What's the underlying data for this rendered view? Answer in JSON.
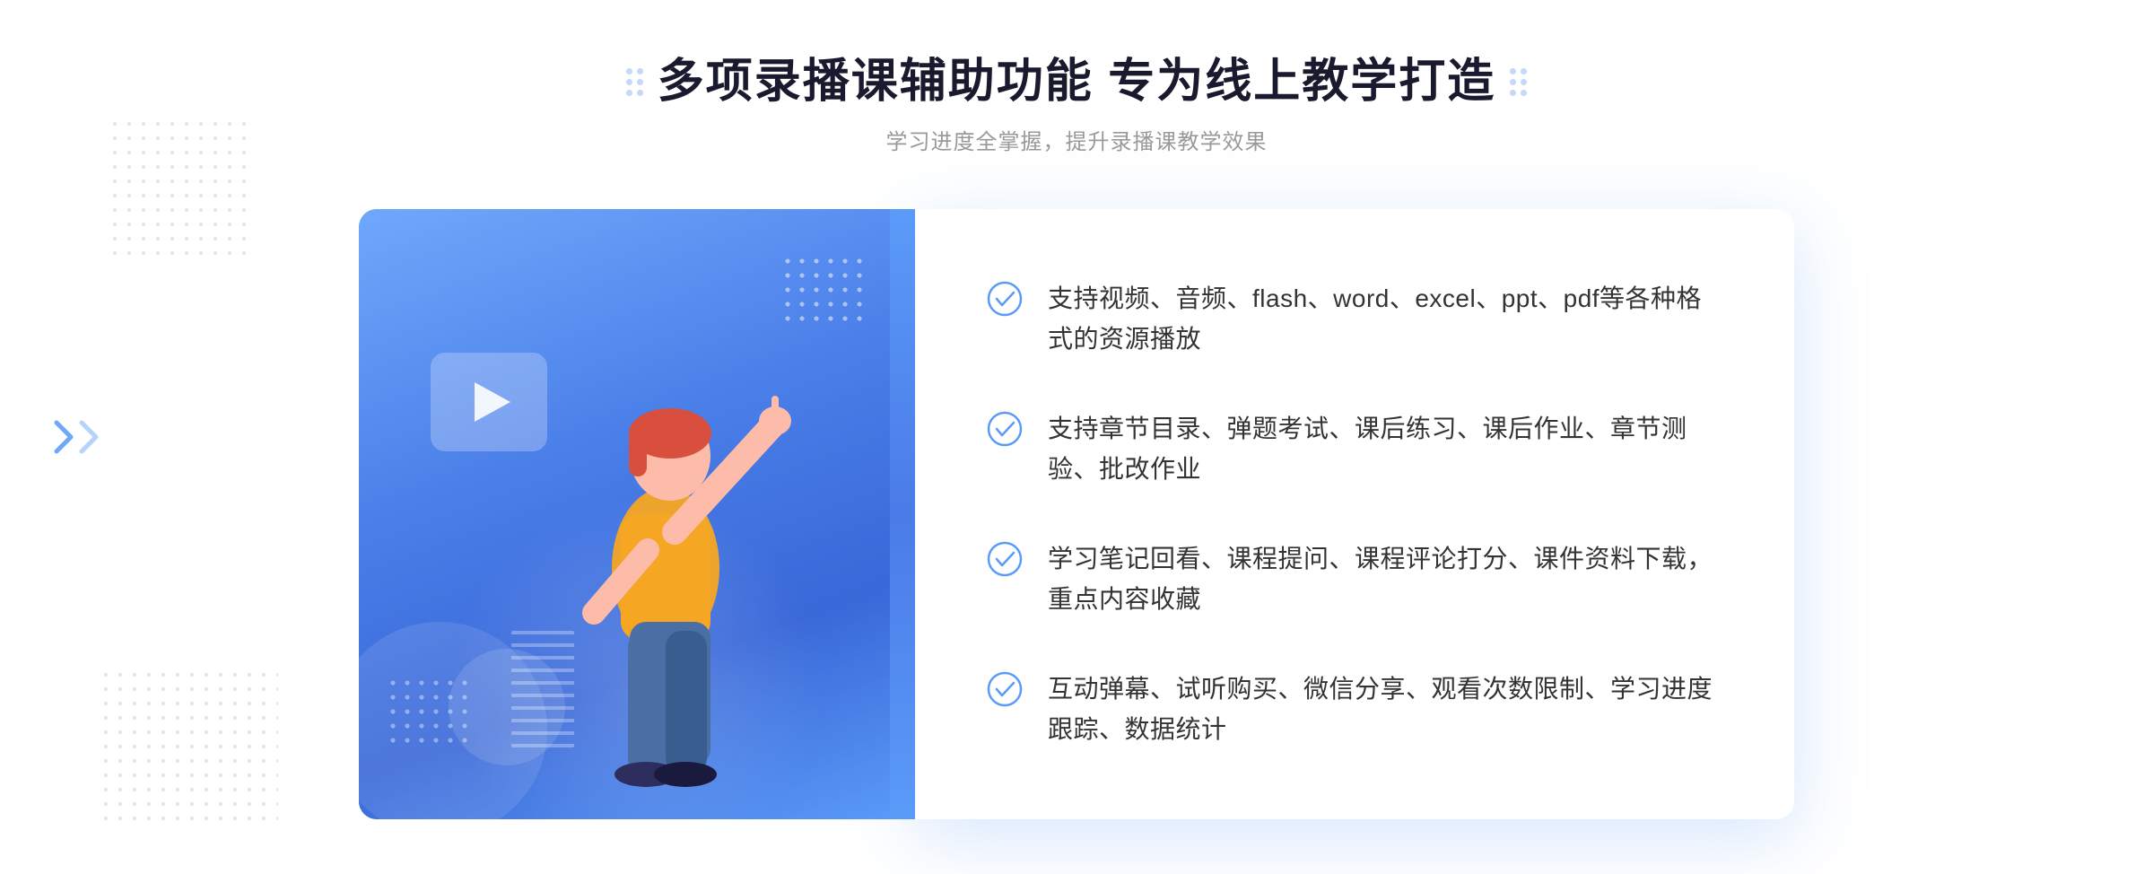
{
  "page": {
    "background": "#ffffff"
  },
  "header": {
    "title": "多项录播课辅助功能 专为线上教学打造",
    "subtitle": "学习进度全掌握，提升录播课教学效果"
  },
  "features": [
    {
      "id": 1,
      "text": "支持视频、音频、flash、word、excel、ppt、pdf等各种格式的资源播放"
    },
    {
      "id": 2,
      "text": "支持章节目录、弹题考试、课后练习、课后作业、章节测验、批改作业"
    },
    {
      "id": 3,
      "text": "学习笔记回看、课程提问、课程评论打分、课件资料下载，重点内容收藏"
    },
    {
      "id": 4,
      "text": "互动弹幕、试听购买、微信分享、观看次数限制、学习进度跟踪、数据统计"
    }
  ],
  "colors": {
    "primary_blue": "#4a85f0",
    "light_blue": "#6fa8fb",
    "dark_blue": "#3968d8",
    "text_dark": "#333333",
    "text_gray": "#999999",
    "title_dark": "#1a1a2e",
    "dot_color": "#c5d8f8",
    "check_color": "#5b9bf8"
  },
  "icons": {
    "check": "check-circle-icon",
    "play": "play-icon",
    "chevron_left": "chevron-left-icon"
  }
}
